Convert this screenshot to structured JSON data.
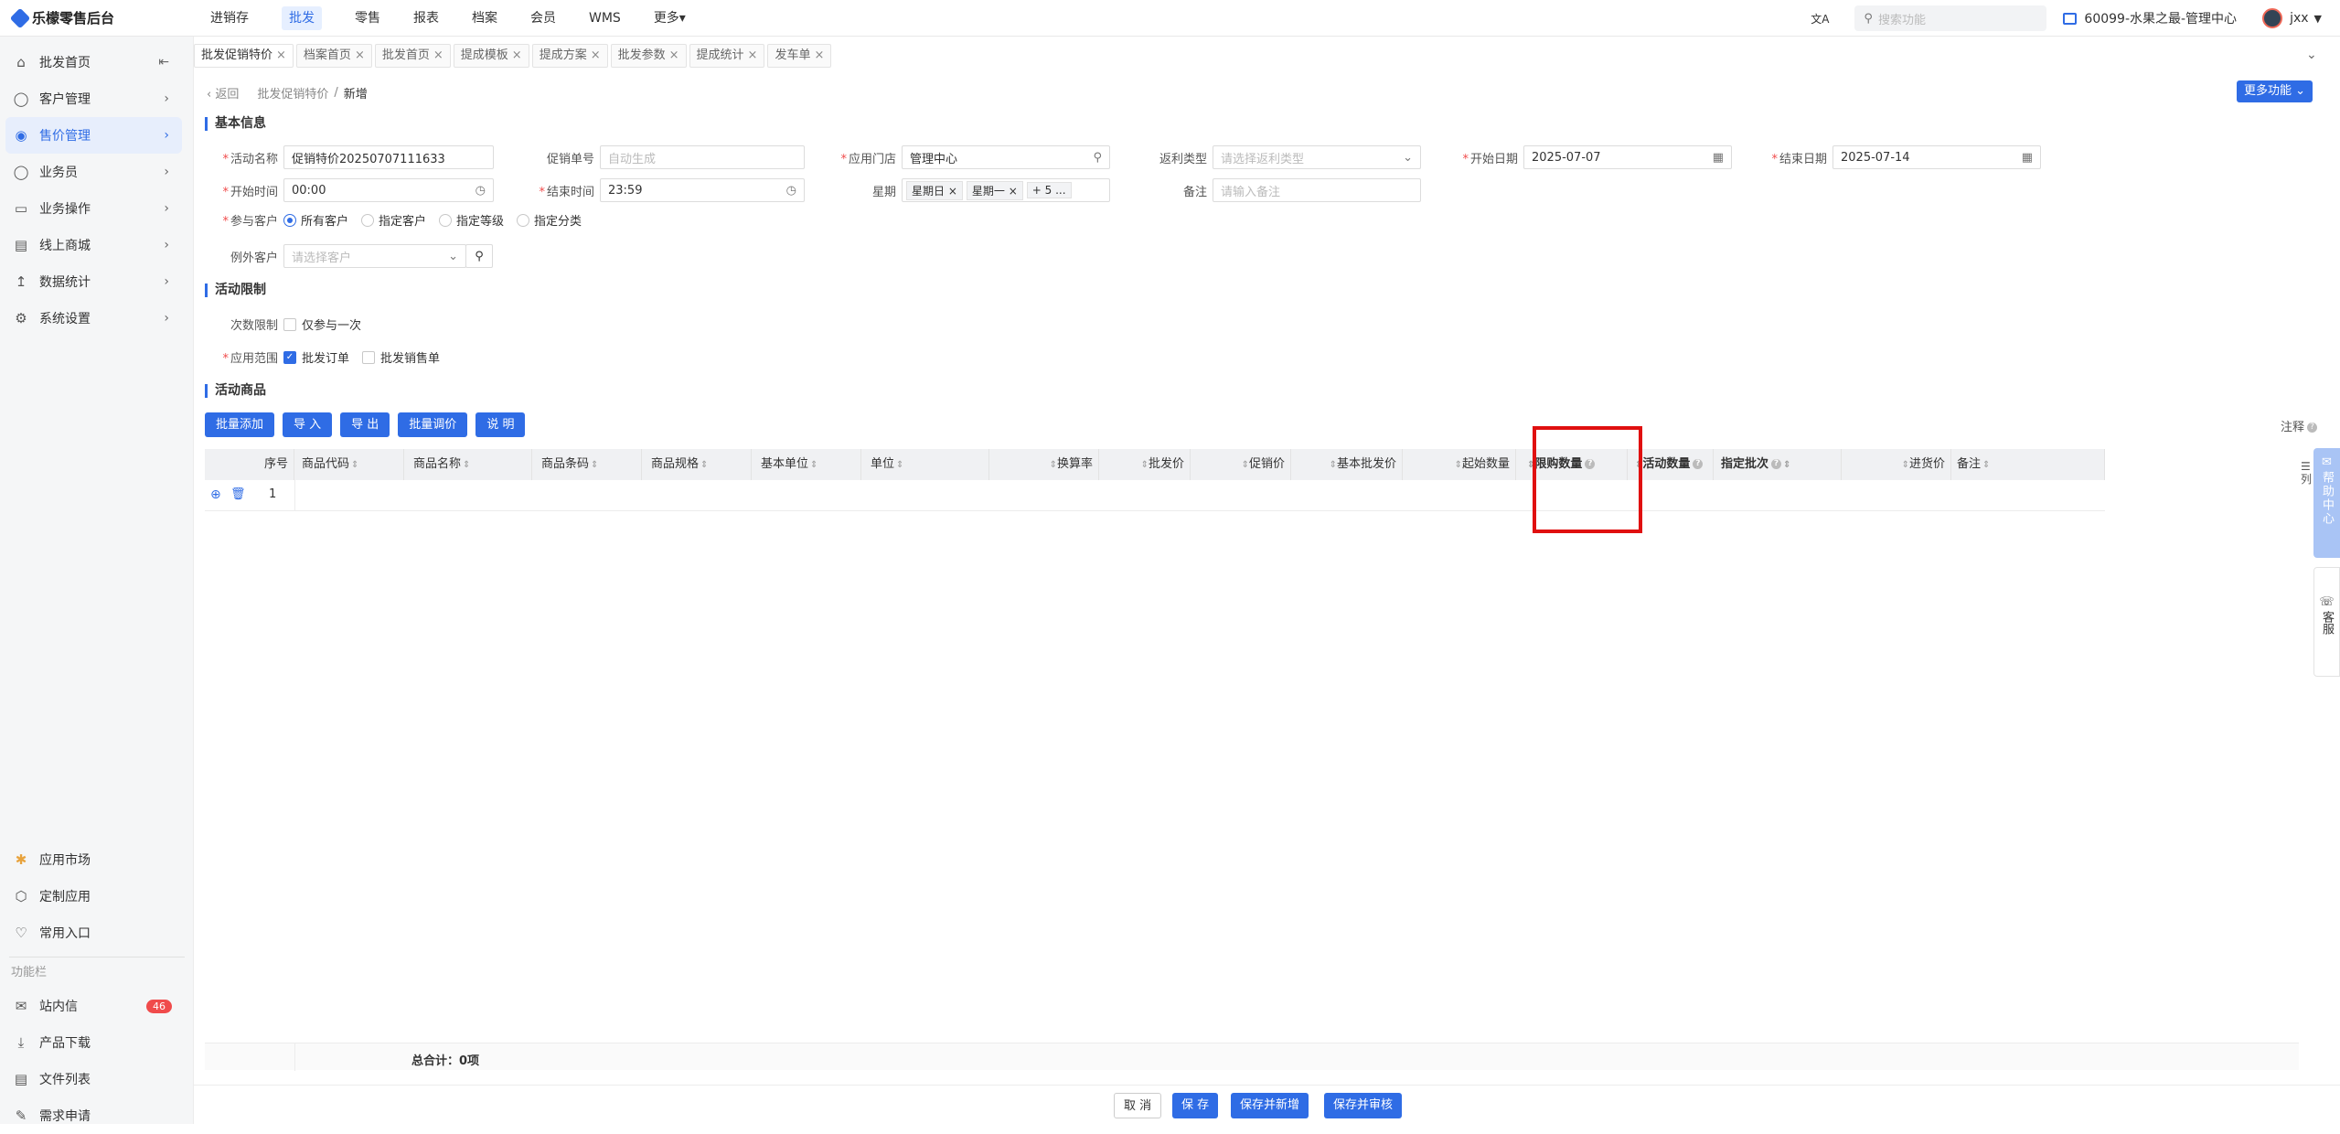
{
  "app": {
    "title": "乐檬零售后台"
  },
  "topnav": {
    "items": [
      {
        "label": "进销存"
      },
      {
        "label": "批发",
        "active": true
      },
      {
        "label": "零售"
      },
      {
        "label": "报表"
      },
      {
        "label": "档案"
      },
      {
        "label": "会员"
      },
      {
        "label": "WMS"
      },
      {
        "label": "更多▾"
      }
    ],
    "search_placeholder": "搜索功能",
    "store": "60099-水果之最-管理中心",
    "user": "jxx",
    "translate_icon": "文A"
  },
  "sidebar": {
    "items": [
      {
        "label": "批发首页",
        "icon": "home-icon"
      },
      {
        "label": "客户管理",
        "icon": "user-icon"
      },
      {
        "label": "售价管理",
        "icon": "price-icon",
        "active": true
      },
      {
        "label": "业务员",
        "icon": "person-icon"
      },
      {
        "label": "业务操作",
        "icon": "operation-icon"
      },
      {
        "label": "线上商城",
        "icon": "shop-icon"
      },
      {
        "label": "数据统计",
        "icon": "chart-icon"
      },
      {
        "label": "系统设置",
        "icon": "settings-icon"
      }
    ],
    "bottom": [
      {
        "label": "应用市场"
      },
      {
        "label": "定制应用"
      },
      {
        "label": "常用入口"
      }
    ],
    "section_label": "功能栏",
    "tools": [
      {
        "label": "站内信",
        "badge": "46"
      },
      {
        "label": "产品下载"
      },
      {
        "label": "文件列表"
      },
      {
        "label": "需求申请"
      }
    ]
  },
  "tabs": [
    {
      "label": "批发促销特价",
      "active": true
    },
    {
      "label": "档案首页"
    },
    {
      "label": "批发首页"
    },
    {
      "label": "提成模板"
    },
    {
      "label": "提成方案"
    },
    {
      "label": "批发参数"
    },
    {
      "label": "提成统计"
    },
    {
      "label": "发车单"
    }
  ],
  "breadcrumb": {
    "back": "返回",
    "parent": "批发促销特价",
    "sep": "/",
    "current": "新增"
  },
  "more_button": "更多功能",
  "basic": {
    "title": "基本信息",
    "activity_name": {
      "label": "活动名称",
      "value": "促销特价20250707111633"
    },
    "promo_no": {
      "label": "促销单号",
      "placeholder": "自动生成"
    },
    "store": {
      "label": "应用门店",
      "value": "管理中心"
    },
    "rebate": {
      "label": "返利类型",
      "placeholder": "请选择返利类型"
    },
    "start_date": {
      "label": "开始日期",
      "value": "2025-07-07"
    },
    "end_date": {
      "label": "结束日期",
      "value": "2025-07-14"
    },
    "start_time": {
      "label": "开始时间",
      "value": "00:00"
    },
    "end_time": {
      "label": "结束时间",
      "value": "23:59"
    },
    "weekday": {
      "label": "星期",
      "chips": [
        "星期日",
        "星期一"
      ],
      "more": "+ 5 ..."
    },
    "remark": {
      "label": "备注",
      "placeholder": "请输入备注"
    },
    "participants": {
      "label": "参与客户",
      "options": [
        "所有客户",
        "指定客户",
        "指定等级",
        "指定分类"
      ],
      "selected": "所有客户"
    },
    "exclude": {
      "label": "例外客户",
      "placeholder": "请选择客户"
    }
  },
  "limit": {
    "title": "活动限制",
    "times_label": "次数限制",
    "times_option": "仅参与一次",
    "scope_label": "应用范围",
    "scope_options": [
      {
        "label": "批发订单",
        "checked": true
      },
      {
        "label": "批发销售单",
        "checked": false
      }
    ]
  },
  "goods": {
    "title": "活动商品",
    "buttons": [
      "批量添加",
      "导 入",
      "导 出",
      "批量调价",
      "说 明"
    ],
    "note": "注释",
    "columns": [
      "序号",
      "商品代码",
      "商品名称",
      "商品条码",
      "商品规格",
      "基本单位",
      "单位",
      "换算率",
      "批发价",
      "促销价",
      "基本批发价",
      "起始数量",
      "限购数量",
      "活动数量",
      "指定批次",
      "进货价",
      "备注"
    ],
    "rows": [
      {
        "index": "1"
      }
    ],
    "total": "总合计：0项",
    "colset": "列"
  },
  "footer": {
    "cancel": "取 消",
    "save": "保 存",
    "save_new": "保存并新增",
    "save_audit": "保存并审核"
  },
  "right_tabs": {
    "help": "帮助中心",
    "service": "客服"
  }
}
